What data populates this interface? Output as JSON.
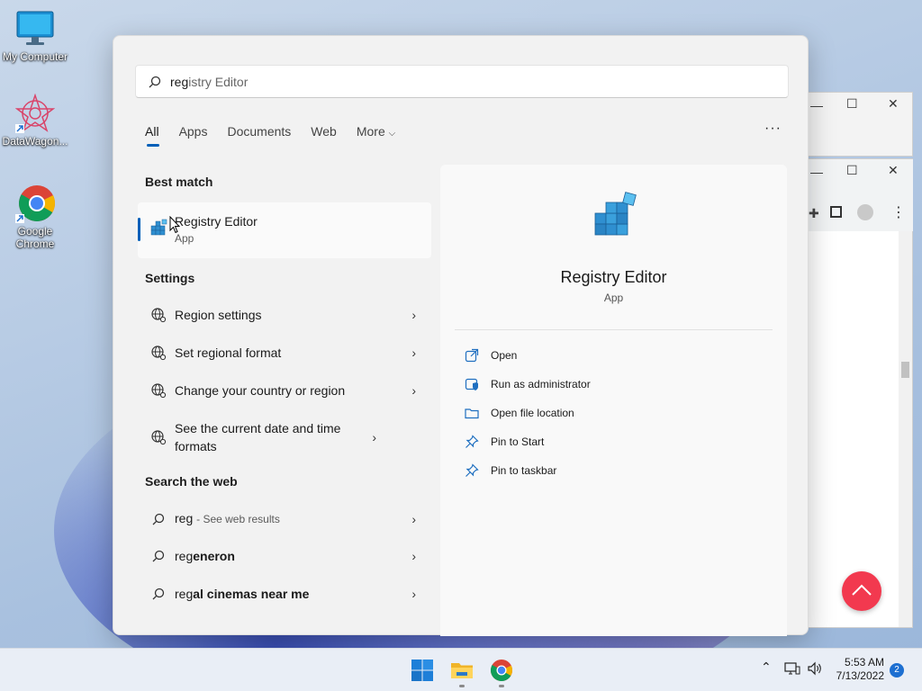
{
  "desktop": {
    "icons": [
      {
        "label": "My Computer"
      },
      {
        "label": "DataWagon..."
      },
      {
        "label": "Google Chrome"
      }
    ]
  },
  "search": {
    "query_highlight": "reg",
    "query_rest": "istry Editor"
  },
  "tabs": [
    "All",
    "Apps",
    "Documents",
    "Web",
    "More"
  ],
  "sections": {
    "best_match": "Best match",
    "settings": "Settings",
    "web": "Search the web"
  },
  "best_match": {
    "name_highlight": "Reg",
    "name_rest": "istry Editor",
    "type": "App"
  },
  "settings_results": [
    {
      "pre": "",
      "hl": "Reg",
      "post": "ion settings"
    },
    {
      "pre": "Set ",
      "hl": "reg",
      "post": "ional format"
    },
    {
      "pre": "Change your country or ",
      "hl": "reg",
      "post": "ion"
    },
    {
      "pre": "",
      "hl": "",
      "post": "See the current date and time formats"
    }
  ],
  "web_results": [
    {
      "hl": "reg",
      "post": "",
      "hint": "- See web results"
    },
    {
      "hl": "reg",
      "post": "eneron",
      "hint": ""
    },
    {
      "hl": "reg",
      "post": "al cinemas near me",
      "hint": ""
    }
  ],
  "detail": {
    "title": "Registry Editor",
    "type": "App",
    "actions": [
      "Open",
      "Run as administrator",
      "Open file location",
      "Pin to Start",
      "Pin to taskbar"
    ]
  },
  "taskbar": {
    "time": "5:53 AM",
    "date": "7/13/2022",
    "notifications": "2"
  },
  "colors": {
    "accent": "#005fb8",
    "fab": "#f2394f"
  }
}
